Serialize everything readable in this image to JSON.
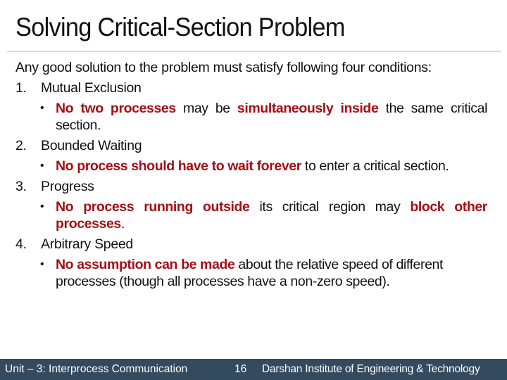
{
  "slide": {
    "title": "Solving Critical-Section Problem",
    "intro": "Any good solution to the problem must satisfy following four conditions:",
    "conditions": [
      {
        "number": "1.",
        "label": "Mutual Exclusion",
        "bullet": [
          {
            "text": "No two processes",
            "emphasis": true
          },
          {
            "text": " may be ",
            "emphasis": false
          },
          {
            "text": "simultaneously inside",
            "emphasis": true
          },
          {
            "text": " the same critical section.",
            "emphasis": false
          }
        ]
      },
      {
        "number": "2.",
        "label": "Bounded Waiting",
        "bullet": [
          {
            "text": "No process should have to wait forever",
            "emphasis": true
          },
          {
            "text": " to enter a critical section.",
            "emphasis": false
          }
        ]
      },
      {
        "number": "3.",
        "label": "Progress",
        "bullet": [
          {
            "text": "No process running outside",
            "emphasis": true
          },
          {
            "text": " its critical region may ",
            "emphasis": false
          },
          {
            "text": "block other processes",
            "emphasis": true
          },
          {
            "text": ".",
            "emphasis": false
          }
        ]
      },
      {
        "number": "4.",
        "label": "Arbitrary Speed",
        "bullet": [
          {
            "text": "No assumption can be made",
            "emphasis": true
          },
          {
            "text": " about the relative speed of different processes (though all processes have a non-zero speed).",
            "emphasis": false
          }
        ]
      }
    ],
    "bullet_glyph": "•"
  },
  "footer": {
    "unit": "Unit – 3: Interprocess Communication",
    "page_number": "16",
    "institute": "Darshan Institute of Engineering & Technology"
  },
  "colors": {
    "emphasis": "#a50e14",
    "footer_bg": "#344a5e",
    "divider": "#d9d9d9"
  }
}
